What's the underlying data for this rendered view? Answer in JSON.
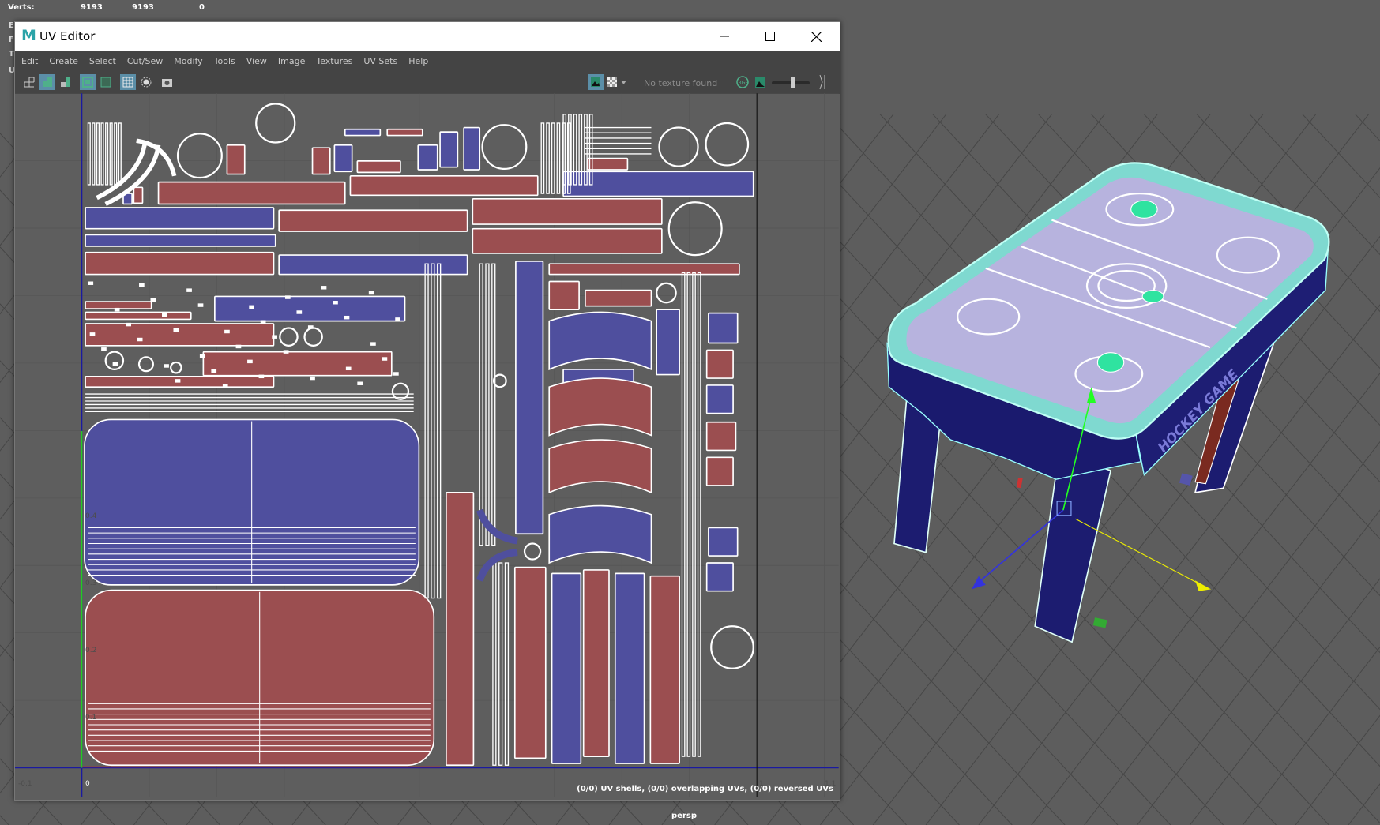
{
  "hud": {
    "label": "Verts:",
    "v1": "9193",
    "v2": "9193",
    "v3": "0",
    "hidden_rows": [
      "E",
      "F",
      "T",
      "U"
    ]
  },
  "window": {
    "title": "UV Editor",
    "logo": "M",
    "controls": {
      "minimize": "minimize-icon",
      "maximize": "maximize-icon",
      "close": "close-icon"
    }
  },
  "menu": [
    "Edit",
    "Create",
    "Select",
    "Cut/Sew",
    "Modify",
    "Tools",
    "View",
    "Image",
    "Textures",
    "UV Sets",
    "Help"
  ],
  "toolbar": {
    "left_icons": [
      "uv-grid-icon",
      "uv-shaded-icon",
      "uv-distortion-icon",
      "uv-border-icon",
      "uv-shell-border-icon",
      "grid-display-icon",
      "soft-select-icon",
      "snapshot-icon"
    ],
    "texture_status": "No texture found",
    "right_icons": [
      "image-display-icon",
      "checker-icon",
      "dropdown-arrow-icon",
      "rgb-channel-icon",
      "image-ratio-icon",
      "exposure-slider",
      "expand-icon"
    ],
    "exposure": 0.5
  },
  "canvas": {
    "axis_labels": {
      "v04": "0.4",
      "v03": "0.3",
      "v02": "0.2",
      "v01": "0.1",
      "v0": "0",
      "u_neg": "-0.1",
      "u1": "1",
      "u11": "1.1"
    },
    "status": "(0/0) UV shells, (0/0) overlapping UVs, (0/0) reversed UVs",
    "colors": {
      "front_face": "#9b4e50",
      "back_face": "#4f4f9e",
      "border": "#ffffff"
    }
  },
  "viewport": {
    "camera": "persp",
    "model_text": "HOCKEY GAME"
  }
}
